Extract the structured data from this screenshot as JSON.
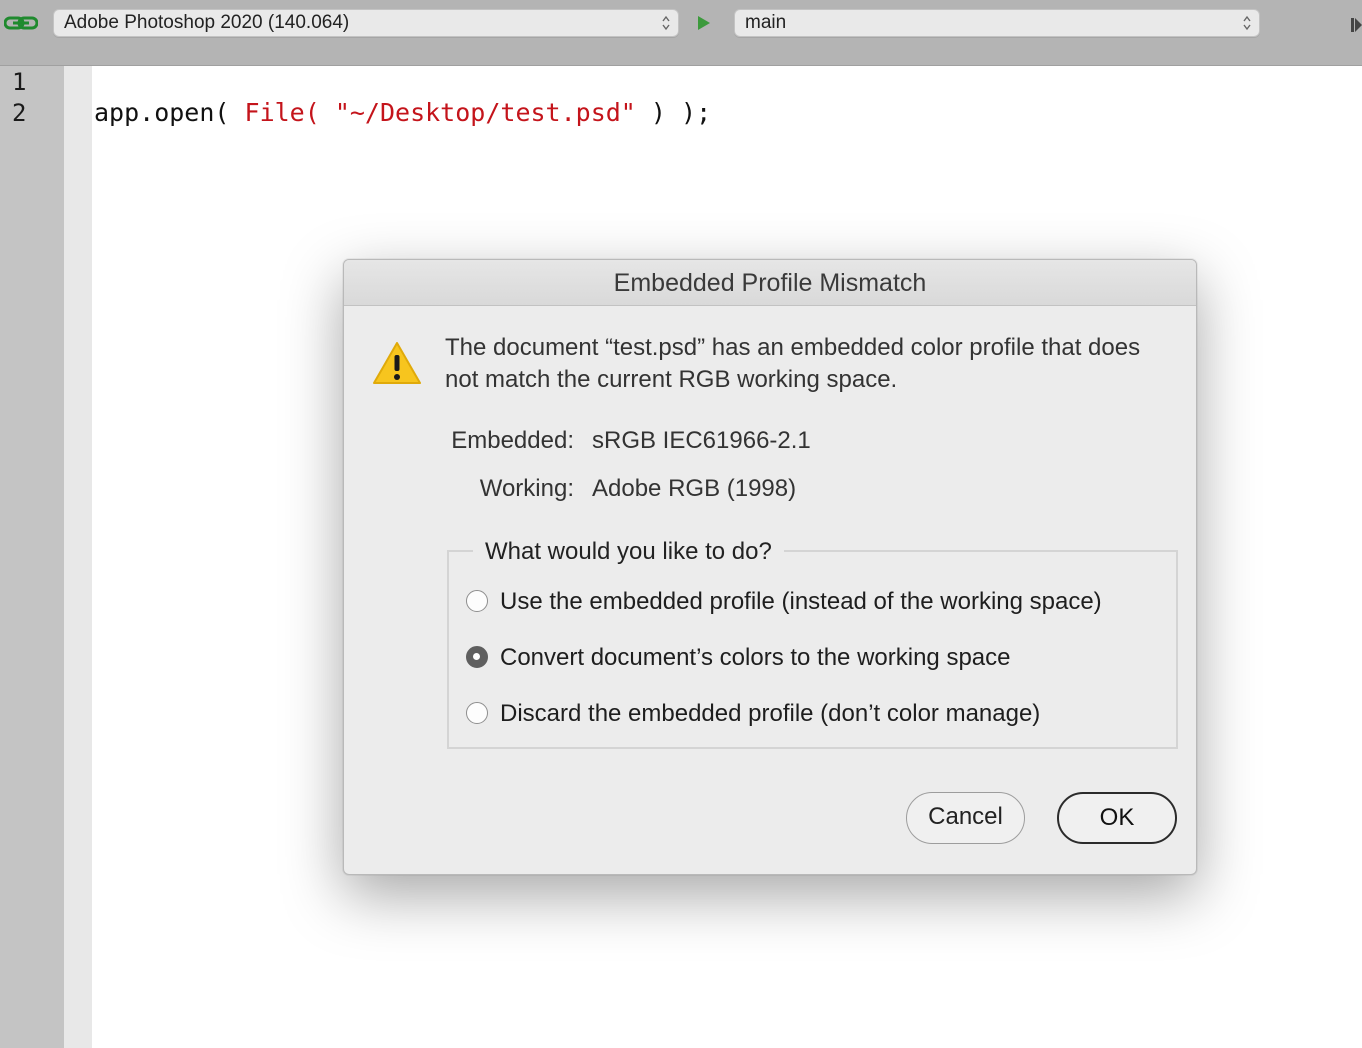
{
  "toolbar": {
    "link_icon": "chain-link-icon",
    "target_app": "Adobe Photoshop 2020 (140.064)",
    "run_icon": "play-icon",
    "function": "main"
  },
  "editor": {
    "line_numbers": [
      "1",
      "2"
    ],
    "code": {
      "t1": "app.open( ",
      "t2": "File( ",
      "t3": "\"~/Desktop/test.psd\"",
      "t4": " ) );"
    }
  },
  "dialog": {
    "title": "Embedded Profile Mismatch",
    "icon": "warning-icon",
    "message": "The document “test.psd” has an embedded color profile that does not match the current RGB working space.",
    "embedded_label": "Embedded:",
    "embedded_value": "sRGB IEC61966-2.1",
    "working_label": "Working:",
    "working_value": "Adobe RGB (1998)",
    "group_title": "What would you like to do?",
    "options": [
      {
        "label": "Use the embedded profile (instead of the working space)",
        "selected": false
      },
      {
        "label": "Convert document’s colors to the working space",
        "selected": true
      },
      {
        "label": "Discard the embedded profile (don’t color manage)",
        "selected": false
      }
    ],
    "cancel_label": "Cancel",
    "ok_label": "OK"
  },
  "colors": {
    "code_red": "#c4141b",
    "warning_yellow": "#f7c51e",
    "run_green": "#3c9a3c"
  }
}
